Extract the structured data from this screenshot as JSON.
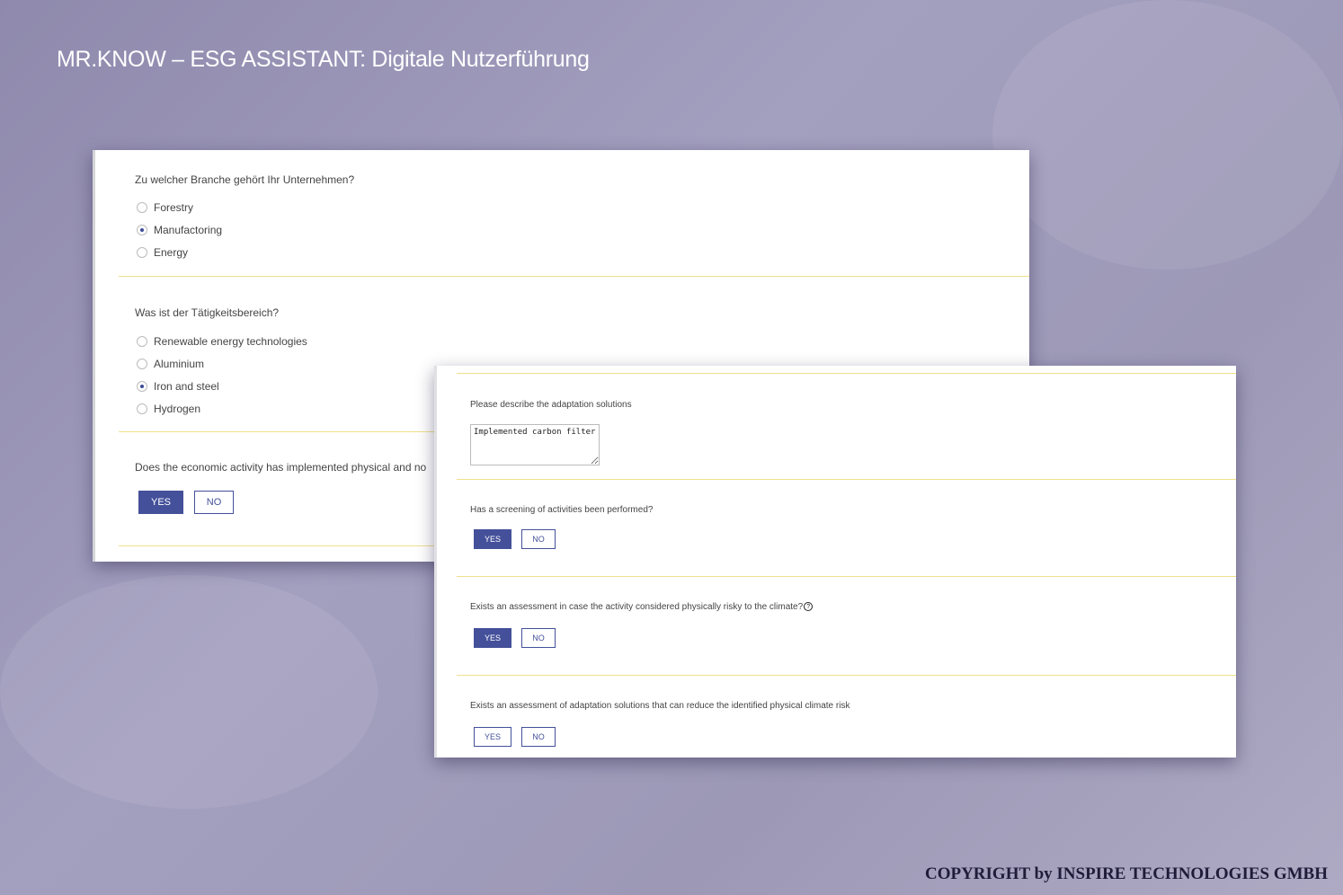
{
  "title": "MR.KNOW – ESG ASSISTANT: Digitale Nutzerführung",
  "copyright": "COPYRIGHT by INSPIRE TECHNOLOGIES GMBH",
  "panel1": {
    "q1": {
      "text": "Zu welcher Branche gehört Ihr Unternehmen?",
      "options": [
        {
          "label": "Forestry",
          "selected": false
        },
        {
          "label": "Manufactoring",
          "selected": true
        },
        {
          "label": "Energy",
          "selected": false
        }
      ]
    },
    "q2": {
      "text": "Was ist der Tätigkeitsbereich?",
      "options": [
        {
          "label": "Renewable energy technologies",
          "selected": false
        },
        {
          "label": "Aluminium",
          "selected": false
        },
        {
          "label": "Iron and steel",
          "selected": true
        },
        {
          "label": "Hydrogen",
          "selected": false
        }
      ]
    },
    "q3": {
      "text": "Does the economic activity has implemented physical and no",
      "yes": "YES",
      "no": "NO",
      "answer": "YES"
    }
  },
  "panel2": {
    "q1": {
      "text": "Please describe the adaptation solutions",
      "value": "Implemented carbon filter"
    },
    "q2": {
      "text": "Has a screening of activities been performed?",
      "yes": "YES",
      "no": "NO",
      "answer": "YES"
    },
    "q3": {
      "text": "Exists an assessment in case the activity considered physically risky to the climate?",
      "help": "?",
      "yes": "YES",
      "no": "NO",
      "answer": "YES"
    },
    "q4": {
      "text": "Exists an assessment of adaptation solutions that can reduce the identified physical climate risk",
      "yes": "YES",
      "no": "NO",
      "answer": null
    }
  },
  "colors": {
    "accent": "#44509a",
    "separator": "#f0e08a"
  }
}
